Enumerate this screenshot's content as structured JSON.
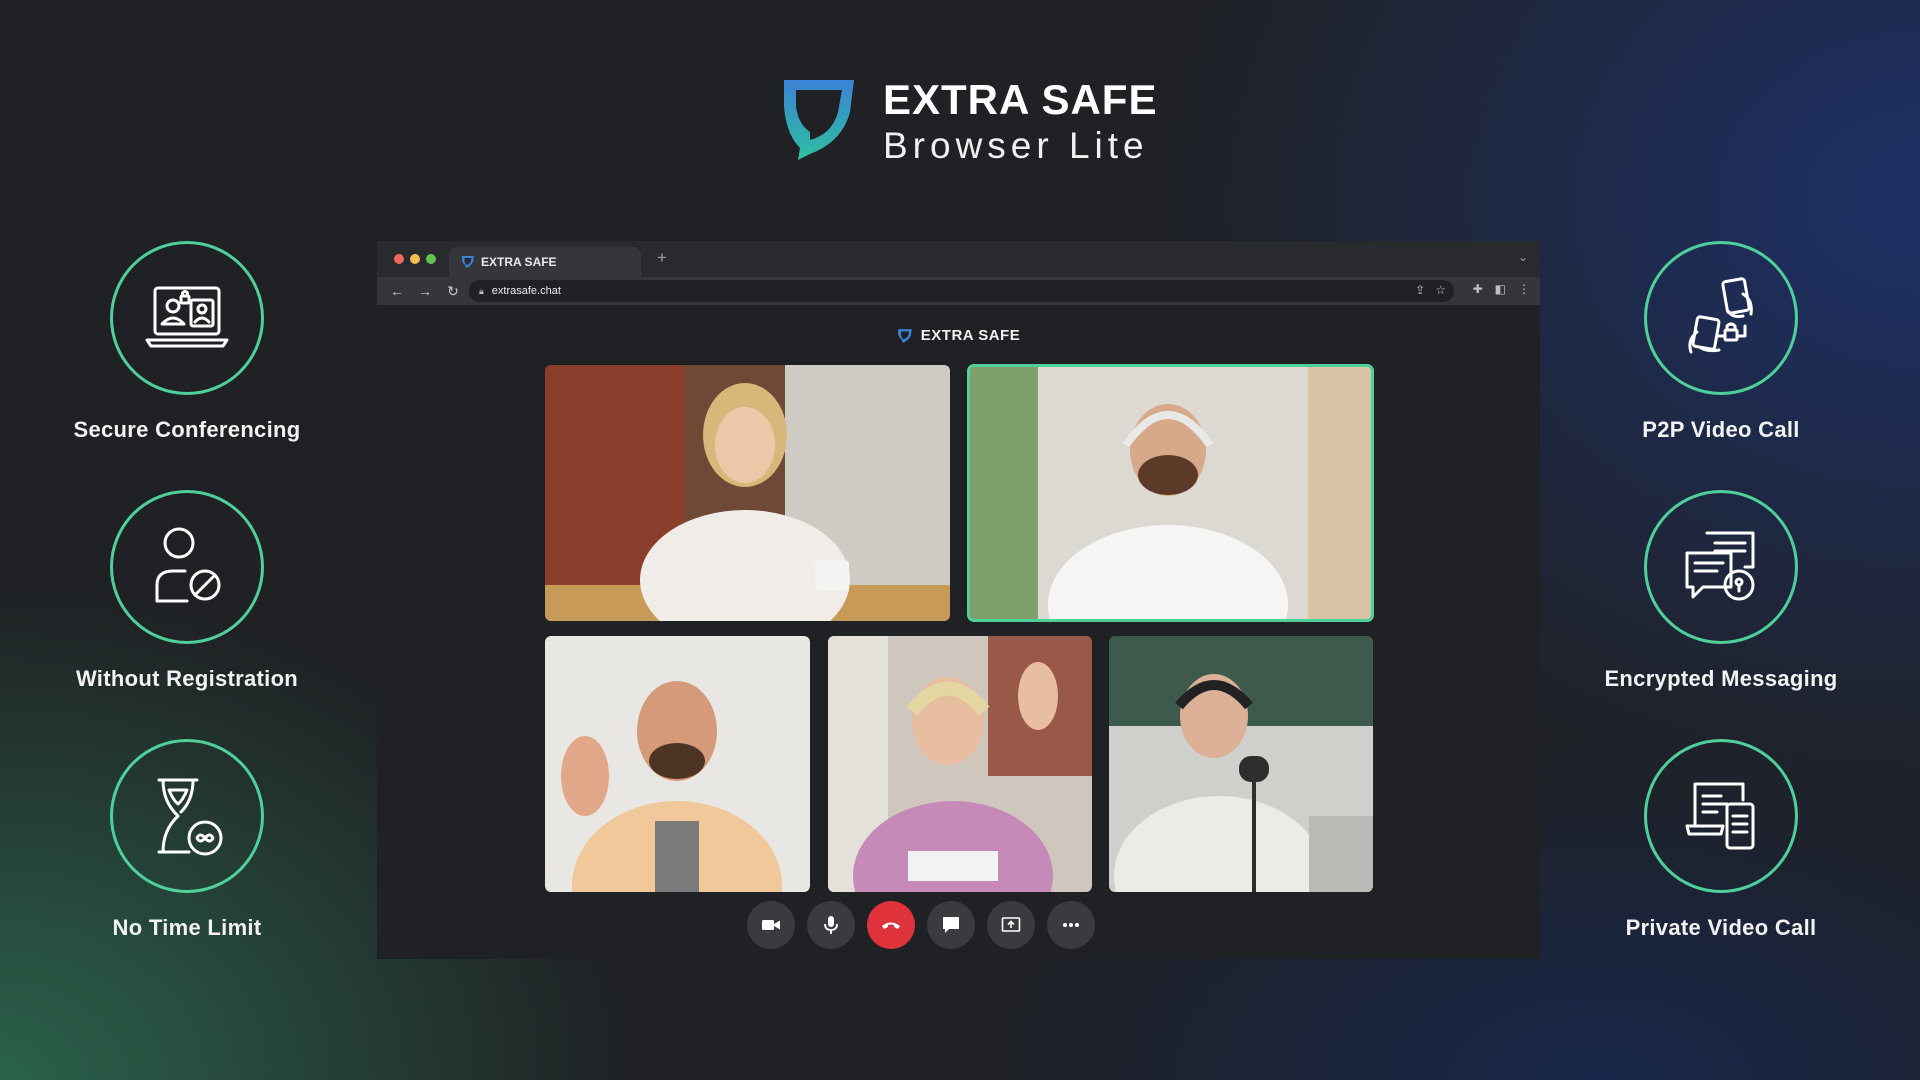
{
  "brand": {
    "title": "EXTRA SAFE",
    "subtitle": "Browser Lite",
    "accent_color": "#4fd09a",
    "logo_colors": [
      "#3b82d6",
      "#2fbfa0"
    ]
  },
  "features_left": [
    {
      "label": "Secure Conferencing",
      "icon": "laptop-users-icon"
    },
    {
      "label": "Without Registration",
      "icon": "user-blocked-icon"
    },
    {
      "label": "No Time Limit",
      "icon": "hourglass-infinity-icon"
    }
  ],
  "features_right": [
    {
      "label": "P2P Video Call",
      "icon": "phones-lock-icon"
    },
    {
      "label": "Encrypted Messaging",
      "icon": "chat-lock-icon"
    },
    {
      "label": "Private Video Call",
      "icon": "devices-icon"
    }
  ],
  "browser": {
    "tab_title": "EXTRA SAFE",
    "url": "extrasafe.chat",
    "window_dots": [
      "#ec6a5e",
      "#f4bf4f",
      "#61c554"
    ],
    "page_title": "EXTRA SAFE"
  },
  "participants": [
    {
      "name": "participant-1",
      "active": false
    },
    {
      "name": "participant-2",
      "active": true
    },
    {
      "name": "participant-3",
      "active": false
    },
    {
      "name": "participant-4",
      "active": false
    },
    {
      "name": "participant-5",
      "active": false
    }
  ],
  "controls": [
    {
      "name": "camera-button",
      "icon": "video-camera-icon"
    },
    {
      "name": "microphone-button",
      "icon": "microphone-icon"
    },
    {
      "name": "end-call-button",
      "icon": "phone-hangup-icon",
      "color": "#e0323a"
    },
    {
      "name": "chat-button",
      "icon": "chat-bubble-icon"
    },
    {
      "name": "share-screen-button",
      "icon": "screen-share-icon"
    },
    {
      "name": "more-options-button",
      "icon": "more-icon"
    }
  ]
}
